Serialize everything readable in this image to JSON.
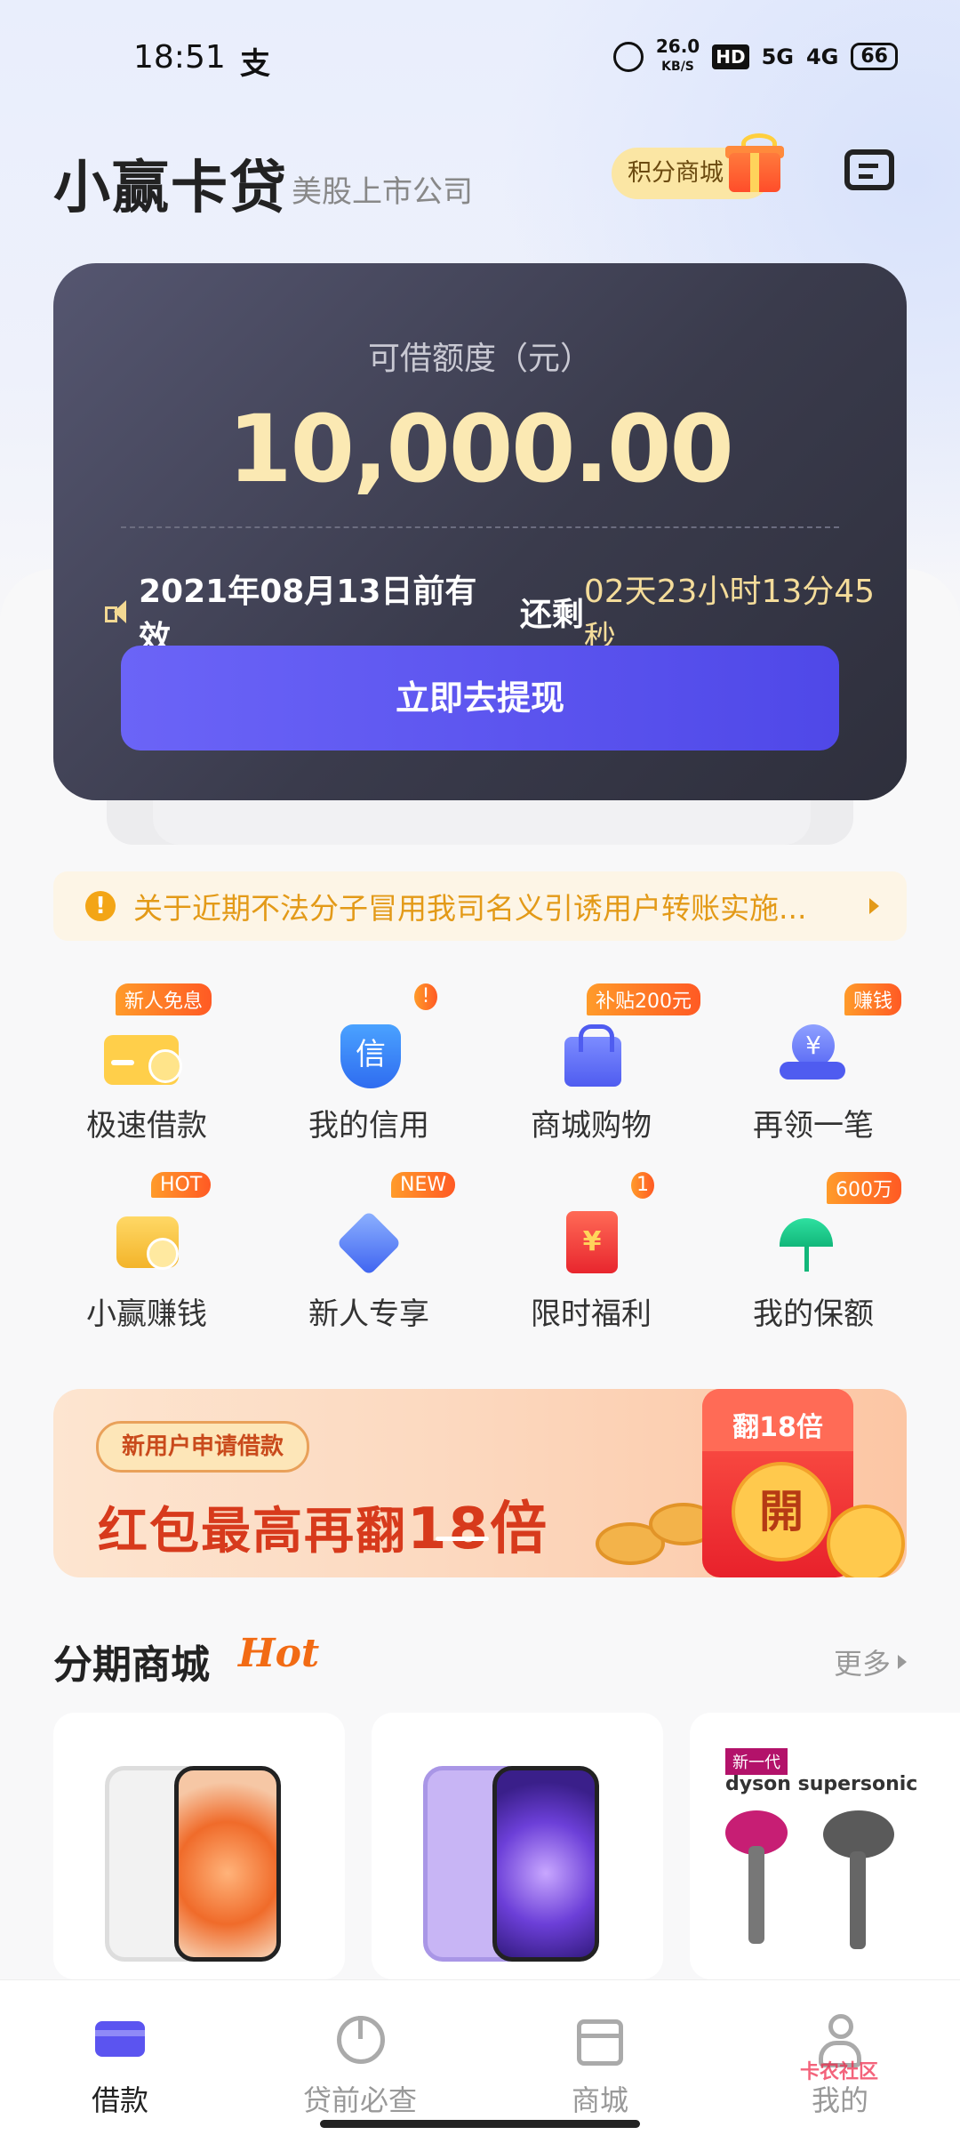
{
  "status_bar": {
    "time": "18:51",
    "alipay_glyph": "支",
    "net_speed": "26.0",
    "net_unit": "KB/S",
    "hd": "HD",
    "sig1": "5G",
    "sig2": "4G",
    "battery": "66"
  },
  "header": {
    "app_name": "小赢卡贷",
    "subtitle": "美股上市公司",
    "points_mall": "积分商城"
  },
  "credit_card": {
    "label": "可借额度（元）",
    "amount": "10,000.00",
    "valid_date": "2021年08月13日前有效",
    "remain_prefix": " 还剩",
    "countdown": "02天23小时13分45秒",
    "cta": "立即去提现"
  },
  "notice": {
    "text": "关于近期不法分子冒用我司名义引诱用户转账实施..."
  },
  "shortcuts": [
    {
      "label": "极速借款",
      "badge": "新人免息",
      "icon": "wallet-icon"
    },
    {
      "label": "我的信用",
      "badge": "!",
      "icon": "credit-shield-icon"
    },
    {
      "label": "商城购物",
      "badge": "补贴200元",
      "icon": "shopping-bag-icon"
    },
    {
      "label": "再领一笔",
      "badge": "赚钱",
      "icon": "yuan-hand-icon"
    },
    {
      "label": "小赢赚钱",
      "badge": "HOT",
      "icon": "coin-wallet-icon"
    },
    {
      "label": "新人专享",
      "badge": "NEW",
      "icon": "diamond-icon"
    },
    {
      "label": "限时福利",
      "badge": "1",
      "icon": "red-envelope-icon"
    },
    {
      "label": "我的保额",
      "badge": "600万",
      "icon": "umbrella-icon"
    }
  ],
  "banner": {
    "pill": "新用户申请借款",
    "headline": "红包最高再翻",
    "multiplier": "18倍",
    "envelope_title": "翻18倍",
    "seal": "開"
  },
  "mall_section": {
    "title": "分期商城",
    "hot": "Hot",
    "more": "更多"
  },
  "products": [
    {
      "name": "white-phone"
    },
    {
      "name": "purple-phone"
    },
    {
      "tag": "新一代",
      "brand": "dyson supersonic"
    }
  ],
  "tabs": [
    {
      "label": "借款",
      "active": true,
      "icon": "card-icon"
    },
    {
      "label": "贷前必查",
      "active": false,
      "icon": "pie-chart-icon"
    },
    {
      "label": "商城",
      "active": false,
      "icon": "store-icon"
    },
    {
      "label": "我的",
      "active": false,
      "icon": "user-icon"
    }
  ],
  "watermark": "卡农社区",
  "colors": {
    "accent": "#5b54f0",
    "gold": "#fbe9b3",
    "warning": "#e39a18",
    "hot": "#f26b14"
  }
}
